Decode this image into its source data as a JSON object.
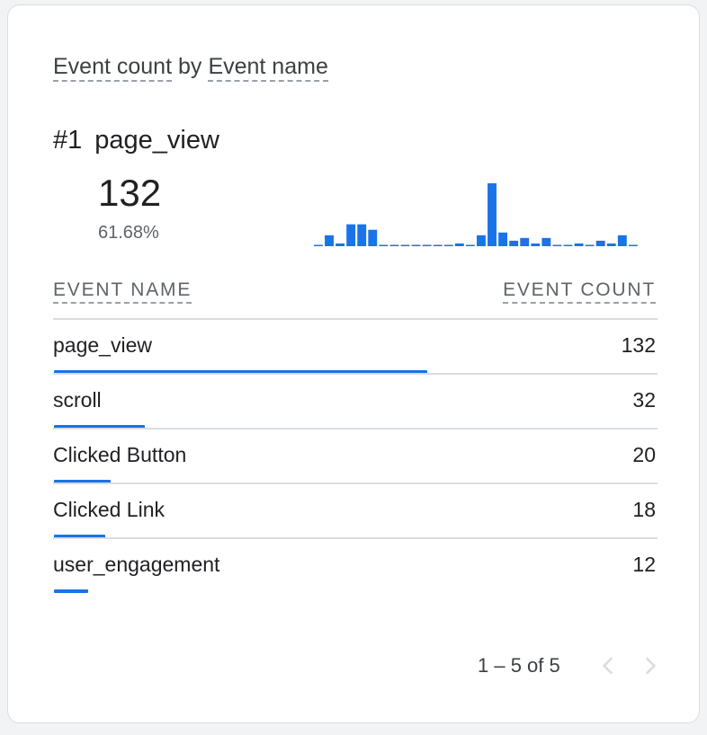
{
  "card": {
    "title_metric": "Event count",
    "title_by": "by",
    "title_dimension": "Event name"
  },
  "top": {
    "rank": "#1",
    "name": "page_view",
    "value": "132",
    "percent": "61.68%"
  },
  "sparkline": {
    "color": "#1a73e8",
    "values": [
      0,
      4,
      1,
      8,
      8,
      6,
      0,
      0,
      0,
      0,
      0,
      0,
      0,
      1,
      0,
      4,
      23,
      5,
      2,
      3,
      1,
      3,
      0,
      0,
      1,
      0,
      2,
      1,
      4,
      0
    ]
  },
  "table": {
    "col_name": "EVENT NAME",
    "col_count": "EVENT COUNT",
    "max_value": 132,
    "rows": [
      {
        "name": "page_view",
        "count": "132",
        "value": 132
      },
      {
        "name": "scroll",
        "count": "32",
        "value": 32
      },
      {
        "name": "Clicked Button",
        "count": "20",
        "value": 20
      },
      {
        "name": "Clicked Link",
        "count": "18",
        "value": 18
      },
      {
        "name": "user_engagement",
        "count": "12",
        "value": 12
      }
    ]
  },
  "pagination": {
    "label": "1 – 5 of 5",
    "prev_icon": "chevron-left-icon",
    "next_icon": "chevron-right-icon"
  }
}
